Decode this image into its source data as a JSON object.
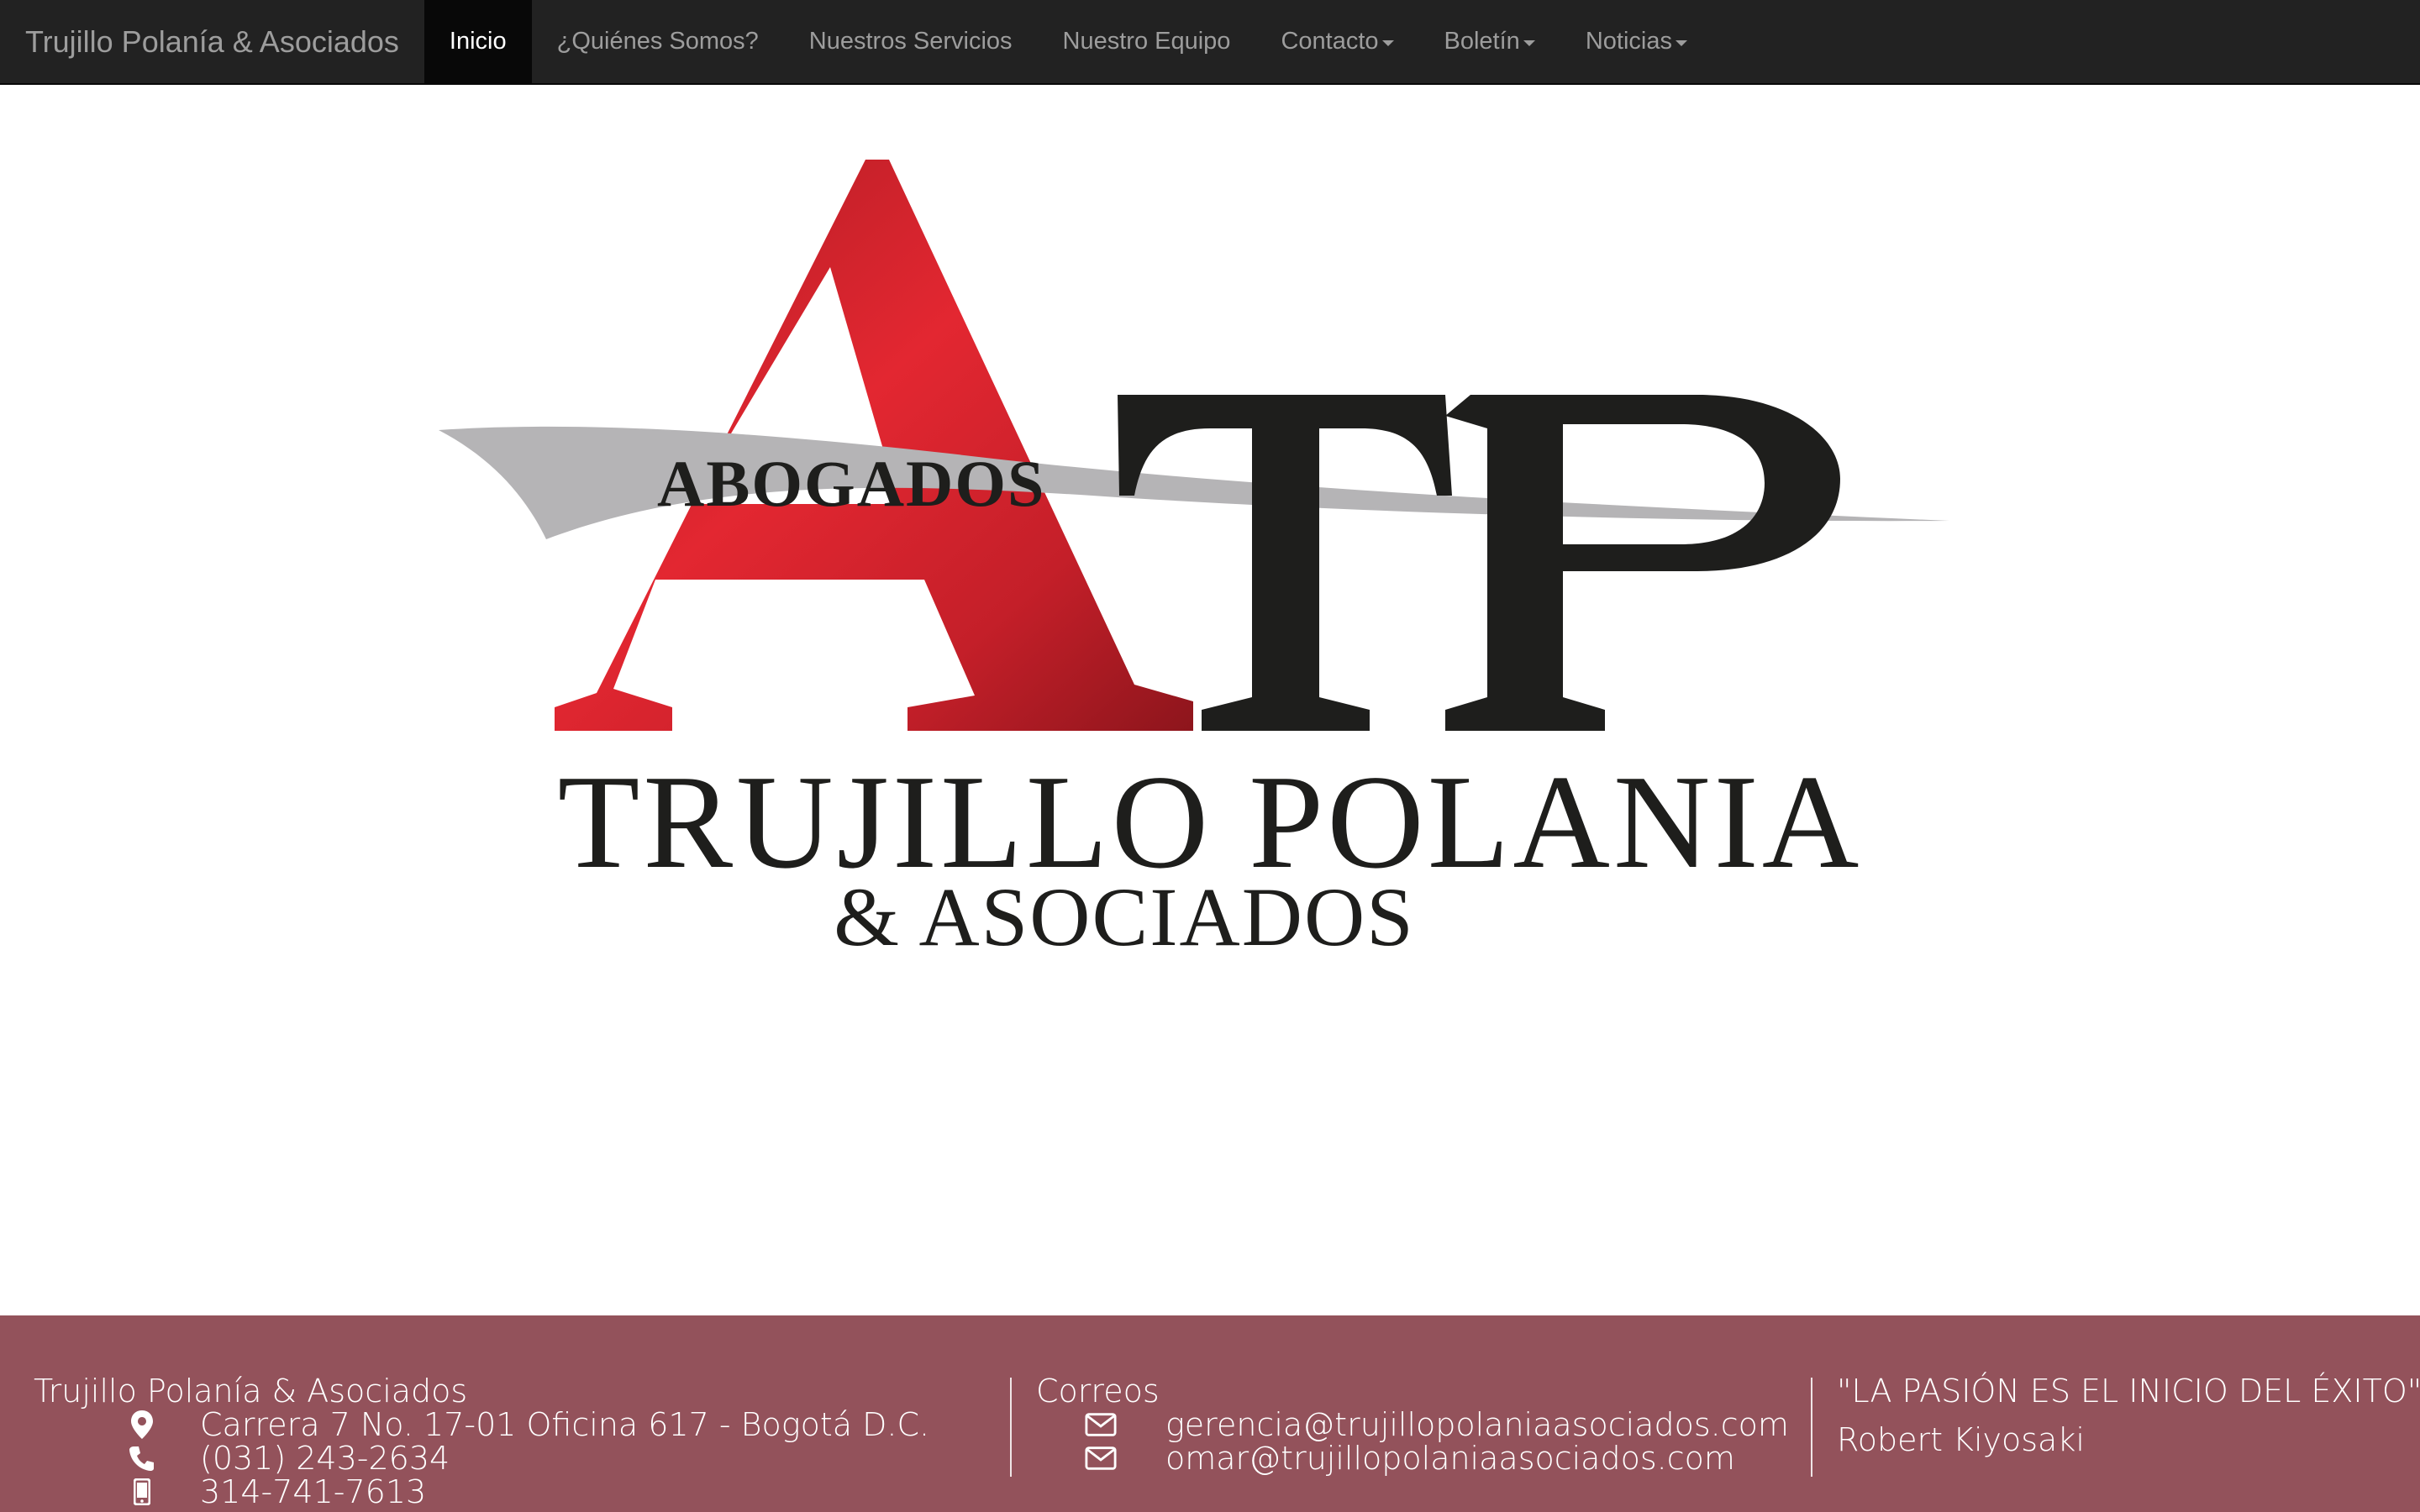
{
  "navbar": {
    "brand": "Trujillo Polanía & Asociados",
    "items": [
      {
        "label": "Inicio",
        "active": true,
        "dropdown": false
      },
      {
        "label": "¿Quiénes Somos?",
        "active": false,
        "dropdown": false
      },
      {
        "label": "Nuestros Servicios",
        "active": false,
        "dropdown": false
      },
      {
        "label": "Nuestro Equipo",
        "active": false,
        "dropdown": false
      },
      {
        "label": "Contacto",
        "active": false,
        "dropdown": true
      },
      {
        "label": "Boletín",
        "active": false,
        "dropdown": true
      },
      {
        "label": "Noticias",
        "active": false,
        "dropdown": true
      }
    ]
  },
  "logo": {
    "monogram": "ATP",
    "tag": "ABOGADOS",
    "name": "TRUJILLO POLANIA",
    "suffix": "& ASOCIADOS"
  },
  "footer": {
    "company": "Trujillo Polanía & Asociados",
    "address": "Carrera 7 No. 17-01 Oficina 617 - Bogotá D.C.",
    "phone": "(031) 243-2634",
    "mobile": "314-741-7613",
    "emails_title": "Correos",
    "email_1": "gerencia@trujillopolaniaasociados.com",
    "email_2": "omar@trujillopolaniaasociados.com",
    "quote": "\"LA PASIÓN ES EL INICIO DEL ÉXITO\"",
    "quote_author": "Robert Kiyosaki"
  },
  "colors": {
    "navbar_bg": "#222222",
    "footer_bg": "#93525b",
    "logo_red": "#d9242f",
    "logo_dark": "#1e1e1c",
    "logo_swoosh": "#b5b4b6"
  },
  "icons": [
    "map-marker-icon",
    "phone-icon",
    "mobile-icon",
    "envelope-icon"
  ]
}
